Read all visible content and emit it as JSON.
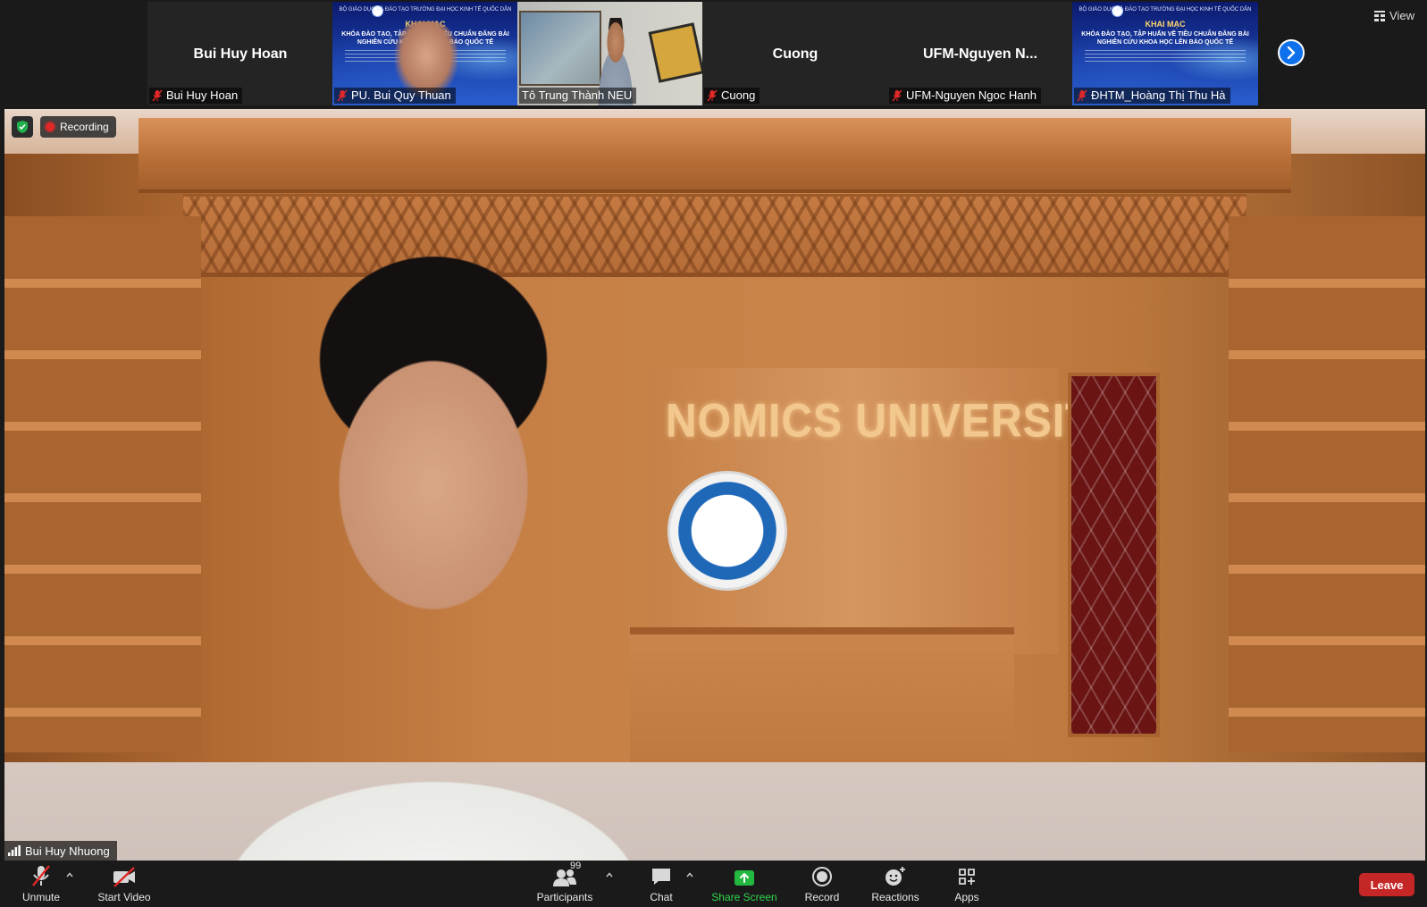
{
  "participants": [
    {
      "big_name": "Bui Huy Hoan",
      "label": "Bui Huy Hoan",
      "muted": true,
      "video": "none"
    },
    {
      "big_name": "",
      "label": "PU. Bui Quy Thuan",
      "muted": true,
      "video": "banner"
    },
    {
      "big_name": "",
      "label": "Tô Trung Thành NEU",
      "muted": false,
      "video": "camera"
    },
    {
      "big_name": "Cuong",
      "label": "Cuong",
      "muted": true,
      "video": "none"
    },
    {
      "big_name": "UFM-Nguyen  N...",
      "label": "UFM-Nguyen Ngoc Hanh",
      "muted": true,
      "video": "none"
    },
    {
      "big_name": "",
      "label": "ĐHTM_Hoàng Thị Thu Hà",
      "muted": true,
      "video": "banner"
    }
  ],
  "banner_text": {
    "top": "BỘ GIÁO DỤC VÀ ĐÀO TẠO\nTRƯỜNG ĐẠI HỌC KINH TẾ QUỐC DÂN",
    "heading": "KHAI MẠC",
    "title": "KHÓA ĐÀO TẠO, TẬP HUẤN VỀ TIÊU CHUẨN ĐĂNG BÀI NGHIÊN CỨU KHOA HỌC LÊN BÁO QUỐC TẾ"
  },
  "view_button": {
    "label": "View",
    "icon": "grid-view-icon"
  },
  "main_video": {
    "recording_label": "Recording",
    "speaker_name": "Bui Huy Nhuong",
    "wall_text": "NOMICS UNIVERSITY"
  },
  "toolbar": {
    "unmute": "Unmute",
    "start_video": "Start Video",
    "participants": "Participants",
    "participants_count": "99",
    "chat": "Chat",
    "share_screen": "Share Screen",
    "record": "Record",
    "reactions": "Reactions",
    "apps": "Apps",
    "leave": "Leave"
  },
  "colors": {
    "accent_blue": "#0e71eb",
    "leave_red": "#c52626",
    "share_green": "#30d64e",
    "mute_red": "#e02828"
  }
}
